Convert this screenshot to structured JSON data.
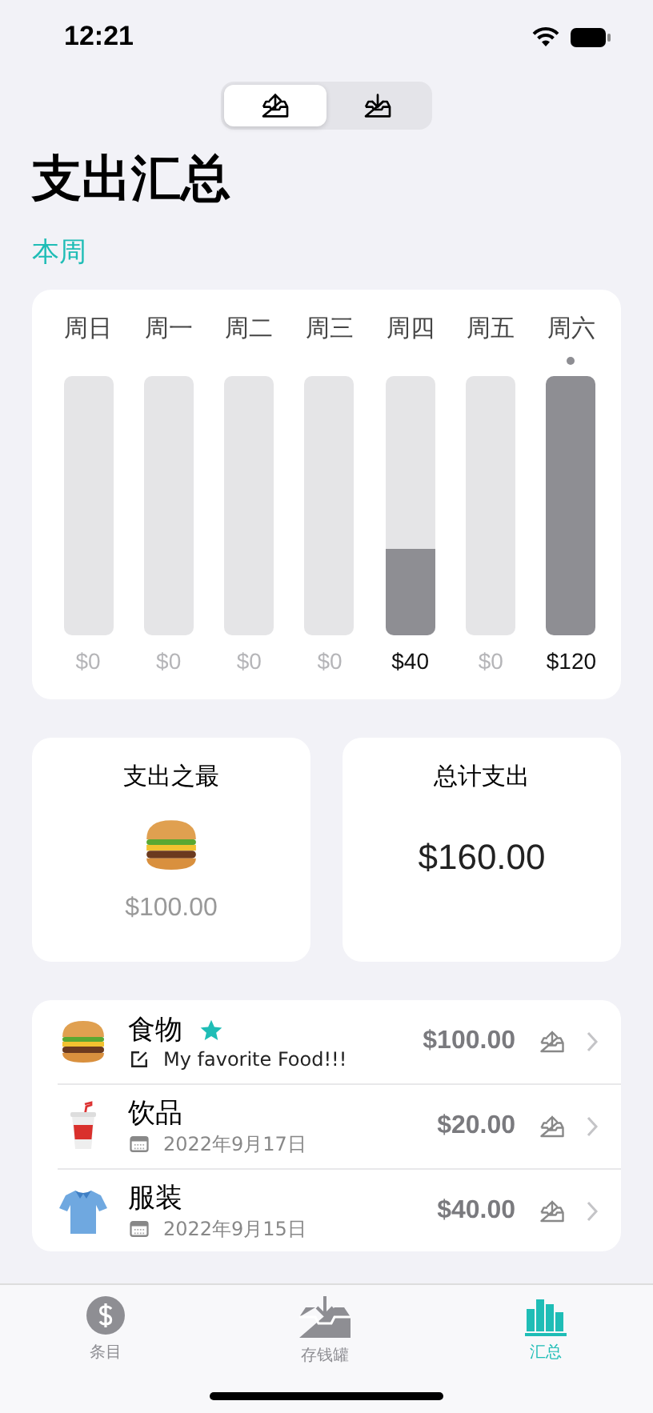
{
  "status_bar": {
    "time": "12:21"
  },
  "segments": [
    {
      "kind": "outgoing",
      "selected": true
    },
    {
      "kind": "incoming",
      "selected": false
    }
  ],
  "title": "支出汇总",
  "section": "本周",
  "week": [
    {
      "label": "周日",
      "amount": "$0",
      "level": 0,
      "today": false
    },
    {
      "label": "周一",
      "amount": "$0",
      "level": 0,
      "today": false
    },
    {
      "label": "周二",
      "amount": "$0",
      "level": 0,
      "today": false
    },
    {
      "label": "周三",
      "amount": "$0",
      "level": 0,
      "today": false
    },
    {
      "label": "周四",
      "amount": "$40",
      "level": 0.333,
      "today": false
    },
    {
      "label": "周五",
      "amount": "$0",
      "level": 0,
      "today": false
    },
    {
      "label": "周六",
      "amount": "$120",
      "level": 1,
      "today": true
    }
  ],
  "top_spending": {
    "title": "支出之最",
    "kind": "food",
    "amount": "$100.00"
  },
  "total": {
    "title": "总计支出",
    "amount": "$160.00"
  },
  "entries": [
    {
      "kind": "food",
      "name": "食物",
      "favorite": true,
      "detail": {
        "kind": "note",
        "text": "My favorite Food!!!"
      },
      "amount": "$100.00"
    },
    {
      "kind": "drink",
      "name": "饮品",
      "favorite": false,
      "detail": {
        "kind": "date",
        "text": "2022年9月17日"
      },
      "amount": "$20.00"
    },
    {
      "kind": "clothing",
      "name": "服装",
      "favorite": false,
      "detail": {
        "kind": "date",
        "text": "2022年9月15日"
      },
      "amount": "$40.00"
    }
  ],
  "tabs": [
    {
      "kind": "entries",
      "label": "条目",
      "selected": false
    },
    {
      "kind": "jar",
      "label": "存钱罐",
      "selected": false
    },
    {
      "kind": "summary",
      "label": "汇总",
      "selected": true
    }
  ]
}
